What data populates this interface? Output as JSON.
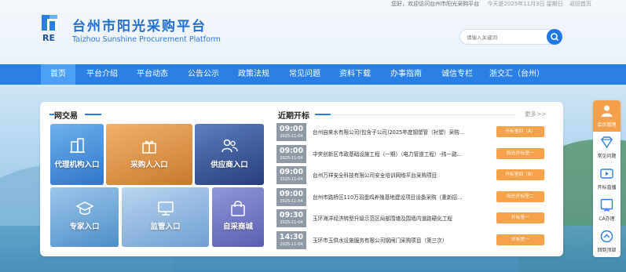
{
  "header": {
    "welcome": "您好，欢迎访问台州市阳光采购平台",
    "date": "今天是2025年11月3日 星期日",
    "back_home": "返回首页",
    "title": "台州市阳光采购平台",
    "subtitle": "Taizhou Sunshine Procurement Platform",
    "logo_text": "RE",
    "search_placeholder": "请输入关键词",
    "search_icon": "search-icon"
  },
  "nav": {
    "items": [
      {
        "label": "首页",
        "active": true
      },
      {
        "label": "平台介绍"
      },
      {
        "label": "平台动态"
      },
      {
        "label": "公告公示"
      },
      {
        "label": "政策法规"
      },
      {
        "label": "常见问题"
      },
      {
        "label": "资料下载"
      },
      {
        "label": "办事指南"
      },
      {
        "label": "诚信专栏"
      },
      {
        "label": "浙交汇（台州）"
      }
    ]
  },
  "left_section": {
    "title": "网交易",
    "tiles": [
      {
        "label": "代理机构入口",
        "icon": "building-icon"
      },
      {
        "label": "采购人入口",
        "icon": "gift-icon"
      },
      {
        "label": "供应商入口",
        "icon": "users-icon"
      },
      {
        "label": "专家入口",
        "icon": "graduation-cap-icon"
      },
      {
        "label": "监管入口",
        "icon": "monitor-icon"
      },
      {
        "label": "自采商城",
        "icon": "shopping-bag-icon"
      }
    ]
  },
  "right_section": {
    "title": "近期开标",
    "more": "更多>>",
    "rows": [
      {
        "time": "09:00",
        "date": "2025-11-04",
        "title": "台州自来水有限公司(包含子公司)2025年度钢塑管（衬塑）采购…",
        "status": "开标室四（A）"
      },
      {
        "time": "09:00",
        "date": "2025-11-04",
        "title": "中央创新区市政基础设施工程（一期）（电力管道工程）-纬一路…",
        "status": "阳光开标室一"
      },
      {
        "time": "09:00",
        "date": "2025-11-04",
        "title": "台州万祥安全科技有限公司安全培训网络平台采购项目",
        "status": "开标室四（B）"
      },
      {
        "time": "09:00",
        "date": "2025-11-04",
        "title": "台州市路桥区110万羽蛋鸡养殖基地建设项目设备采购（重新招…",
        "status": "阳光开标室二"
      },
      {
        "time": "09:30",
        "date": "2025-11-04",
        "title": "玉环海洋经济转型升级示范区局部围塘及围墙内道路硬化工程",
        "status": "开标室一"
      },
      {
        "time": "14:30",
        "date": "2025-11-04",
        "title": "玉环市玉供水设施服务有限公司钢闸门采购项目（第三次）",
        "status": "开标室一"
      }
    ]
  },
  "sidebar": {
    "items": [
      {
        "label": "会员管理",
        "icon": "user-icon",
        "active": true
      },
      {
        "label": "常见问题",
        "icon": "diamond-icon"
      },
      {
        "label": "开标直播",
        "icon": "video-icon"
      },
      {
        "label": "CA办理",
        "icon": "ca-certificate-icon"
      },
      {
        "label": "回到顶部",
        "icon": "arrow-up-icon"
      }
    ]
  },
  "colors": {
    "primary": "#2a7fe6",
    "nav_active": "#4ba0f5",
    "button_orange": "#f6a24a",
    "time_gray": "#8f9aa6"
  }
}
